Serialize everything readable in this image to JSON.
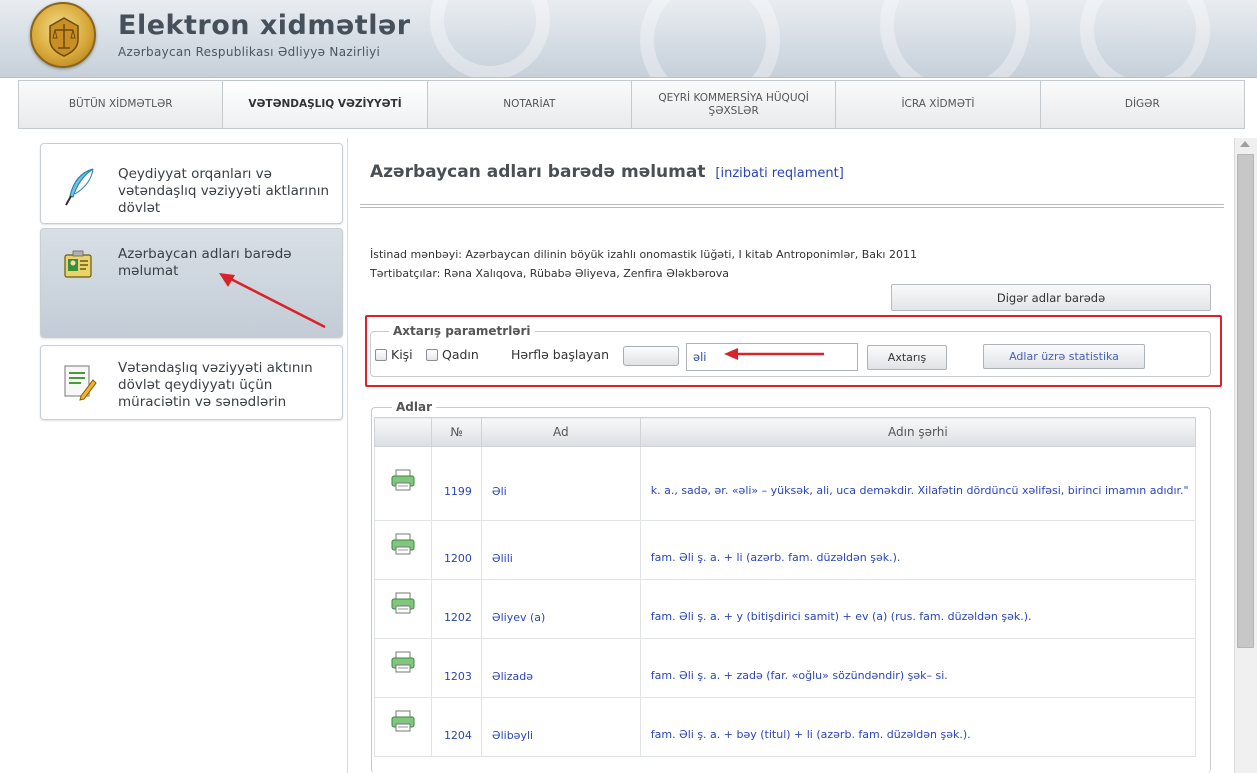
{
  "header": {
    "title": "Elektron xidmətlər",
    "subtitle": "Azərbaycan Respublikası Ədliyyə Nazirliyi"
  },
  "nav": {
    "tabs": [
      {
        "label": "BÜTÜN XİDMƏTLƏR"
      },
      {
        "label": "VƏTƏNDAŞLIQ VƏZİYYƏTİ"
      },
      {
        "label": "NOTARİAT"
      },
      {
        "label": "QEYRİ KOMMERSİYA HÜQUQİ ŞƏXSLƏR"
      },
      {
        "label": "İCRA XİDMƏTİ"
      },
      {
        "label": "DİGƏR"
      }
    ]
  },
  "sidebar": {
    "items": [
      {
        "label": "Qeydiyyat orqanları və vətəndaşlıq vəziyyəti aktlarının dövlət"
      },
      {
        "label": "Azərbaycan adları barədə məlumat"
      },
      {
        "label": "Vətəndaşlıq vəziyyəti aktının dövlət qeydiyyatı üçün müraciətin və sənədlərin"
      }
    ]
  },
  "main": {
    "title": "Azərbaycan adları barədə məlumat",
    "title_link": "[inzibati reqlament]",
    "source": "İstinad mənbəyi: Azərbaycan dilinin böyük izahlı onomastik lüğəti, I kitab Antroponimlər, Bakı 2011",
    "authors": "Tərtibatçılar: Rəna Xalıqova, Rübabə Əliyeva, Zenfira Ələkbərova",
    "other_names_button": "Digər adlar barədə"
  },
  "search": {
    "legend": "Axtarış parametrləri",
    "male_label": "Kişi",
    "female_label": "Qadın",
    "starts_with_label": "Hərflə başlayan",
    "query": "əli",
    "search_button": "Axtarış",
    "stats_button": "Adlar üzrə statistika"
  },
  "results": {
    "legend": "Adlar",
    "columns": [
      "",
      "№",
      "Ad",
      "Adın şərhi"
    ],
    "rows": [
      {
        "num": "1199",
        "name": "Əli",
        "desc": "k. a., sadə, ər. «əli» – yüksək, ali, uca deməkdir. Xilafətin dördüncü xəlifəsi, birinci imamın adıdır.\""
      },
      {
        "num": "1200",
        "name": "Əlili",
        "desc": "fam. Əli ş. a. + li (azərb. fam. düzəldən şək.)."
      },
      {
        "num": "1202",
        "name": "Əliyev (a)",
        "desc": "fam. Əli ş. a. + y (bitişdirici samit) + ev (a) (rus. fam. düzəldən şək.)."
      },
      {
        "num": "1203",
        "name": "Əlizadə",
        "desc": "fam. Əli ş. a. + zadə (far. «oğlu» sözündəndir) şək– si."
      },
      {
        "num": "1204",
        "name": "Əlibəyli",
        "desc": "fam. Əli ş. a. + bəy (titul) + li (azərb. fam. düzəldən şək.)."
      }
    ]
  },
  "colors": {
    "link": "#2b45b8",
    "annotation": "#d8232a"
  }
}
